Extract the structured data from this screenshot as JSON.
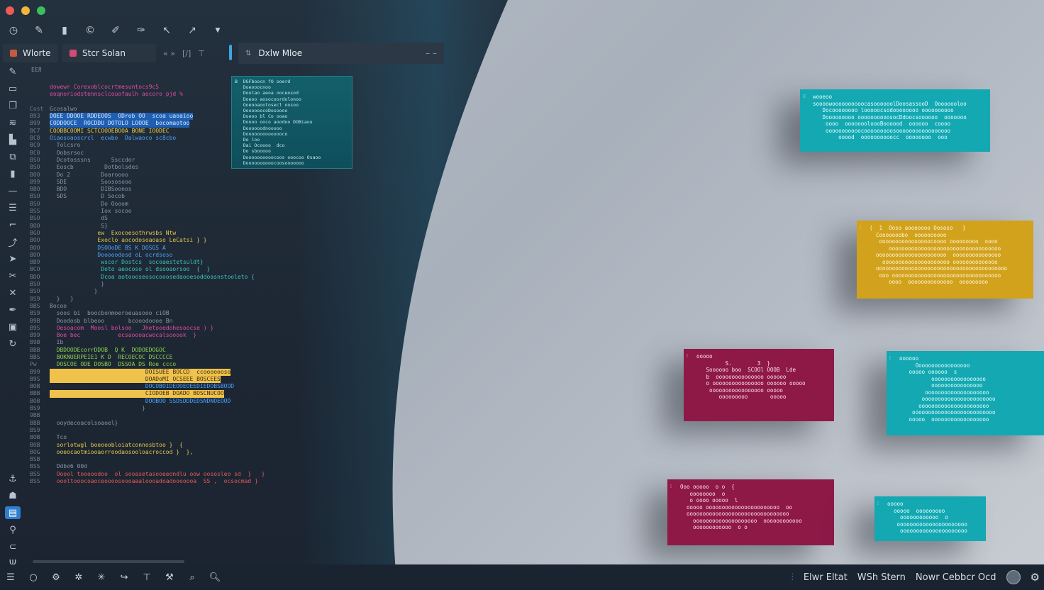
{
  "window": {
    "traffic_lights": [
      "close",
      "minimize",
      "zoom"
    ]
  },
  "toolbar": {
    "icons": [
      "history-icon",
      "pen-icon",
      "file-icon",
      "copyright-icon",
      "edit-icon",
      "brush-icon",
      "undo-icon",
      "pin-icon",
      "chevron-down-icon"
    ]
  },
  "tabs": [
    {
      "label": "Wlorte",
      "color": "#c65a3f"
    },
    {
      "label": "Stcr Solan",
      "color": "#d34a72"
    }
  ],
  "tab_controls": [
    "« »",
    "[/]",
    "⊤"
  ],
  "document_tab": {
    "label": "Dxlw Mloe",
    "minimize": "– –"
  },
  "editor": {
    "header": "ЕЕЛ",
    "lines": [
      {
        "num": "",
        "text": "dowewr Corexoblcocrtmesuntocs9c5",
        "cls": "c-pink"
      },
      {
        "num": "",
        "text": "eoqnoriodstennsclcouofaulh aocoro pjd %",
        "cls": "c-pink"
      },
      {
        "num": "",
        "text": "",
        "cls": "c-white"
      },
      {
        "num": "Cost",
        "text": "Gcosalwo",
        "cls": "c-grey"
      },
      {
        "num": "B93",
        "text": "DOEE DDOOE RDDEOOS  ODrob OO  scoa uaoaioo",
        "cls": "hl-blue"
      },
      {
        "num": "B99",
        "text": "CODDOOCE  ROCDDU DOTOLO LOOOE  bocomaotoo",
        "cls": "hl-blue"
      },
      {
        "num": "BC7",
        "text": "COOBBCOOMI SCTCOOOEBOOA BONE IOODEC",
        "cls": "c-yellow"
      },
      {
        "num": "BC8",
        "text": "Oiaosoaoscrcl  ecwbo  Dalwaoco sc8cbo",
        "cls": "c-blue"
      },
      {
        "num": "BC9",
        "text": "  Tolcsro",
        "cls": "c-grey"
      },
      {
        "num": "BC0",
        "text": "  Oobsrsoc",
        "cls": "c-grey"
      },
      {
        "num": "BSO",
        "text": "  Dcotosssns      Ssccdor",
        "cls": "c-grey"
      },
      {
        "num": "BSO",
        "text": "  Eoscb         Dotbolsdes",
        "cls": "c-grey"
      },
      {
        "num": "BOO",
        "text": "  Do 2         Doaroooo",
        "cls": "c-grey"
      },
      {
        "num": "B99",
        "text": "  SDE          Soososooo",
        "cls": "c-grey"
      },
      {
        "num": "BBO",
        "text": "  BDO          DIBSoonos",
        "cls": "c-grey"
      },
      {
        "num": "BSO",
        "text": "  SDS          D Socob",
        "cls": "c-grey"
      },
      {
        "num": "BSO",
        "text": "               Do Oooom",
        "cls": "c-grey"
      },
      {
        "num": "BSS",
        "text": "               Iox socoo",
        "cls": "c-grey"
      },
      {
        "num": "BSO",
        "text": "               dS",
        "cls": "c-grey"
      },
      {
        "num": "BOO",
        "text": "               S}",
        "cls": "c-grey"
      },
      {
        "num": "BGO",
        "text": "              ew  Exocoesothrwsbs Ntw",
        "cls": "c-yellow"
      },
      {
        "num": "BOO",
        "text": "              Exoclo aocodosoaoaso LeCatsi } }",
        "cls": "c-yellow"
      },
      {
        "num": "BOO",
        "text": "              DSOOoDE BS K DOSGS A",
        "cls": "c-blue"
      },
      {
        "num": "BOO",
        "text": "              Dooooodosd oL ocrdsoso",
        "cls": "c-blue"
      },
      {
        "num": "BB9",
        "text": "               wscor Dostcs  socoaestetsuldt}",
        "cls": "c-teal"
      },
      {
        "num": "BCO",
        "text": "               Doto aeocoso ol dsooaorsoo  {  }",
        "cls": "c-teal"
      },
      {
        "num": "BDO",
        "text": "               Dcoa aotoooseosocooosedaooesoddoasnstooleto {",
        "cls": "c-teal"
      },
      {
        "num": "BSO",
        "text": "               }",
        "cls": "c-grey"
      },
      {
        "num": "BSO",
        "text": "             }",
        "cls": "c-grey"
      },
      {
        "num": "8S9",
        "text": "  }   }",
        "cls": "c-grey"
      },
      {
        "num": "BBS",
        "text": "Bocoo",
        "cls": "c-grey"
      },
      {
        "num": "BS9",
        "text": "  soos bi  boocbonmoeroeuasooo ciOB",
        "cls": "c-grey"
      },
      {
        "num": "B9B",
        "text": "  Doodosb blbeoo       bcooodoooe Bn",
        "cls": "c-grey"
      },
      {
        "num": "B9S",
        "text": "  Oesoacom  Moosl bolsoo   Jhetooedohesoocse ) }",
        "cls": "c-pink"
      },
      {
        "num": "B99",
        "text": "  Boe bec           ecsaoooacwocalsooook  }",
        "cls": "c-pink"
      },
      {
        "num": "B9B",
        "text": "  Ib",
        "cls": "c-grey"
      },
      {
        "num": "BBB",
        "text": "  DBDOODEcorrDDOB  Q K  DODOEDOGOC",
        "cls": "c-green"
      },
      {
        "num": "BBS",
        "text": "  BOKNUERPEIE1 K D  RECOECOC DSCCCCE",
        "cls": "c-green"
      },
      {
        "num": "Pw",
        "text": "  DOSCOE ODE DOSBO  DSSOA DS Roe ccco",
        "cls": "c-green"
      },
      {
        "num": "B99",
        "text": "                            DOISUEE BOCCD  ccooooooso",
        "cls": "hl-yellow"
      },
      {
        "num": "B9S",
        "text": "                            DOADoMI OCSEEE BOSCEES",
        "cls": "hl-yellow"
      },
      {
        "num": "BOB",
        "text": "                            DOCOBOIDEOOEOEEDIEDOBSBOOD",
        "cls": "c-blue"
      },
      {
        "num": "BBB",
        "text": "                            CIODOEB DOADO BOSCNUCOO",
        "cls": "hl-yellow"
      },
      {
        "num": "BOB",
        "text": "                            DOOBOO SSDSDDDEDSNDNOEOOD",
        "cls": "c-blue"
      },
      {
        "num": "BS9",
        "text": "                           }",
        "cls": "c-grey"
      },
      {
        "num": "9BB",
        "text": "",
        "cls": "c-grey"
      },
      {
        "num": "BBB",
        "text": "  ooydecoacolsoaoel}",
        "cls": "c-grey"
      },
      {
        "num": "BS9",
        "text": "",
        "cls": "c-grey"
      },
      {
        "num": "BOB",
        "text": "  Tco",
        "cls": "c-grey"
      },
      {
        "num": "BOB",
        "text": "  sorlotwgl boeooobloiatconnosbtoo }  {",
        "cls": "c-yellow"
      },
      {
        "num": "BOG",
        "text": "  ooeocaotmiooaorroodaosooloacroccod }  },",
        "cls": "c-yellow"
      },
      {
        "num": "BSB",
        "text": "",
        "cls": "c-grey"
      },
      {
        "num": "BSS",
        "text": "  Ddbo6 00d",
        "cls": "c-grey"
      },
      {
        "num": "BSS",
        "text": "  Ooool tooooodoo  ol sooasetasooeeondlu oow oososleo sd  }   }",
        "cls": "c-red"
      },
      {
        "num": "BSS",
        "text": "  oooltooocoaoceoooosoooaaaloooadoadooooooa  SS ,  ocsocmad }",
        "cls": "c-red"
      }
    ]
  },
  "popup": {
    "lines": [
      "B  DGFboocn fO ooerd",
      "   Doeooocnoo",
      "   Dootao aeoa ooceosod",
      "   Doeoo aosocoordolonoo",
      "   Ooeooaootosecl oosoo",
      "   OoooooocoDosoooo",
      "   Doeoo bl Co ooao",
      "   Doooo ooco aoodoo DOBiaou",
      "   Doooooodnooooo",
      "   Doooooooooooooco",
      "   Do loo",
      "   Dai Ocoooo  dco",
      "   Do sbooooo",
      "   Doooooooooocoos ooocoo Osaoo",
      "   Doooooooooocoosooooooo"
    ]
  },
  "cards": [
    {
      "name": "card-teal-top",
      "theme": "teal",
      "lines": [
        "wooeoo",
        "soooowoooooooooocasoooooolDoosassooD  Oooooooloo",
        "   Docoooooooo looooocsodoooooooo oooooooooo",
        "   Dooooooooo oooooooooosocDdoocsoooooo  ooooooo",
        "    oooo  oooooooloooBoooood  oooooo  coooo",
        "    ooooooooooocooooooooosooooooooooooooooo",
        "        ooood  oooooooooocc  oooooooo  ooo"
      ]
    },
    {
      "name": "card-gold",
      "theme": "gold",
      "lines": [
        "(  1  Ooso aooeoooo Oososo   }",
        "  Cooooooobo  oooooooooo",
        "   oooooooooooooooocoooo ooooooooo  oooo",
        "      ooooooooooooooooooooooooooooooooooo",
        "  oooooooooooooooooooooo  ooooooooooooooo",
        "    ooooooooooooooooooooo oooooooooooooo",
        "  ooooooooooooooooooooooooooooooooooooooooo",
        "   ooo oooooooooooooooooooooooooooooooooo",
        "      oooo  oooooooooooooo  ooooooooo"
      ]
    },
    {
      "name": "card-crimson-mid",
      "theme": "crimson",
      "lines": [
        "ooooo",
        "         S.        3  }",
        "   Soooooo boo  SCOOl OOOB  Lde",
        "   b  ooooooooooooooo oooooo",
        "   o oooooooooooooooo oooooo ooooo",
        "    ooooooooooooooooo ooooo",
        "       ooooooooo       ooooo"
      ]
    },
    {
      "name": "card-teal-right",
      "theme": "teal",
      "lines": [
        "oooooo",
        "     Ooooooooooooooooo",
        "   ooooo oooooo  s",
        "          ooooooooooooooooo",
        "          oooooooooooooooo",
        "        oooooooooooooooooooo",
        "       ooooooooooooooooooooooo",
        "      oooooooooooooooooooooo",
        "    oooooooooooooooooooooooooo",
        "   ooooo  oooooooooooooooooo"
      ]
    },
    {
      "name": "card-crimson-bottom",
      "theme": "crimson",
      "lines": [
        "Ooo ooooo  o o  {",
        "   oooooooo  o",
        "   o oooo ooooo  l",
        "  ooooo ooooooooooooooooooooooo  oo",
        "  oooooooooooooooooooooooooooooooo",
        "    oooooooooooooooooooo  oooooooooooo",
        "    oooooooooooo  o o"
      ]
    },
    {
      "name": "card-teal-bottom",
      "theme": "teal",
      "lines": [
        "ooooo",
        "  ooooo  ooooooooo",
        "    oooooooooooo  o",
        "   oooooooooooooooooooooo",
        "    ooooooooooooooooooooo"
      ]
    }
  ],
  "statusbar": {
    "left_icons": [
      "menu-icon",
      "circle-icon",
      "extensions-icon",
      "debug-icon",
      "run-icon",
      "redo-icon",
      "filter-icon",
      "tools-icon",
      "find-file-icon",
      "search-icon"
    ],
    "right_items": [
      "Elwr Eltat",
      "WSh Stern",
      "Nowr Cebbcr Ocd"
    ]
  },
  "colors": {
    "accent_blue": "#3aa7e0",
    "teal": "#13a8b2",
    "gold": "#d2a21d",
    "crimson": "#8e1947"
  }
}
